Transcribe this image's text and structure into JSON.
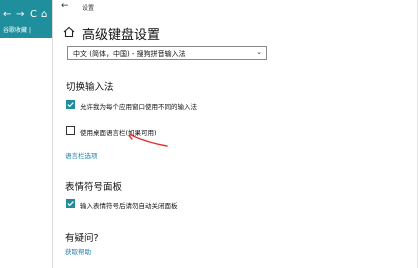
{
  "background_browser": {
    "nav_back": "←",
    "nav_forward": "→",
    "nav_refresh": "C",
    "nav_home": "⌂",
    "bookmark_label": "谷歌收藏",
    "bookmark_sep": "|"
  },
  "window": {
    "back_glyph": "←",
    "app_title": "设置",
    "page_title": "高级键盘设置",
    "input_method_dropdown": {
      "selected": "中文 (简体，中国) - 搜狗拼音输入法"
    },
    "switch_input_section": {
      "title": "切换输入法",
      "options": [
        {
          "label": "允许我为每个应用窗口使用不同的输入法",
          "checked": true
        },
        {
          "label": "使用桌面语言栏(如果可用)",
          "checked": false
        }
      ],
      "language_bar_link": "语言栏选项"
    },
    "emoji_panel_section": {
      "title": "表情符号面板",
      "options": [
        {
          "label": "输入表情符号后请勿自动关闭面板",
          "checked": true
        }
      ]
    },
    "help_section": {
      "title": "有疑问?",
      "link": "获取帮助"
    }
  },
  "colors": {
    "accent": "#1e8c9a",
    "link": "#1e7fb0",
    "annotation_arrow": "#e0332e",
    "browser_toolbar": "#1f8f9e"
  }
}
